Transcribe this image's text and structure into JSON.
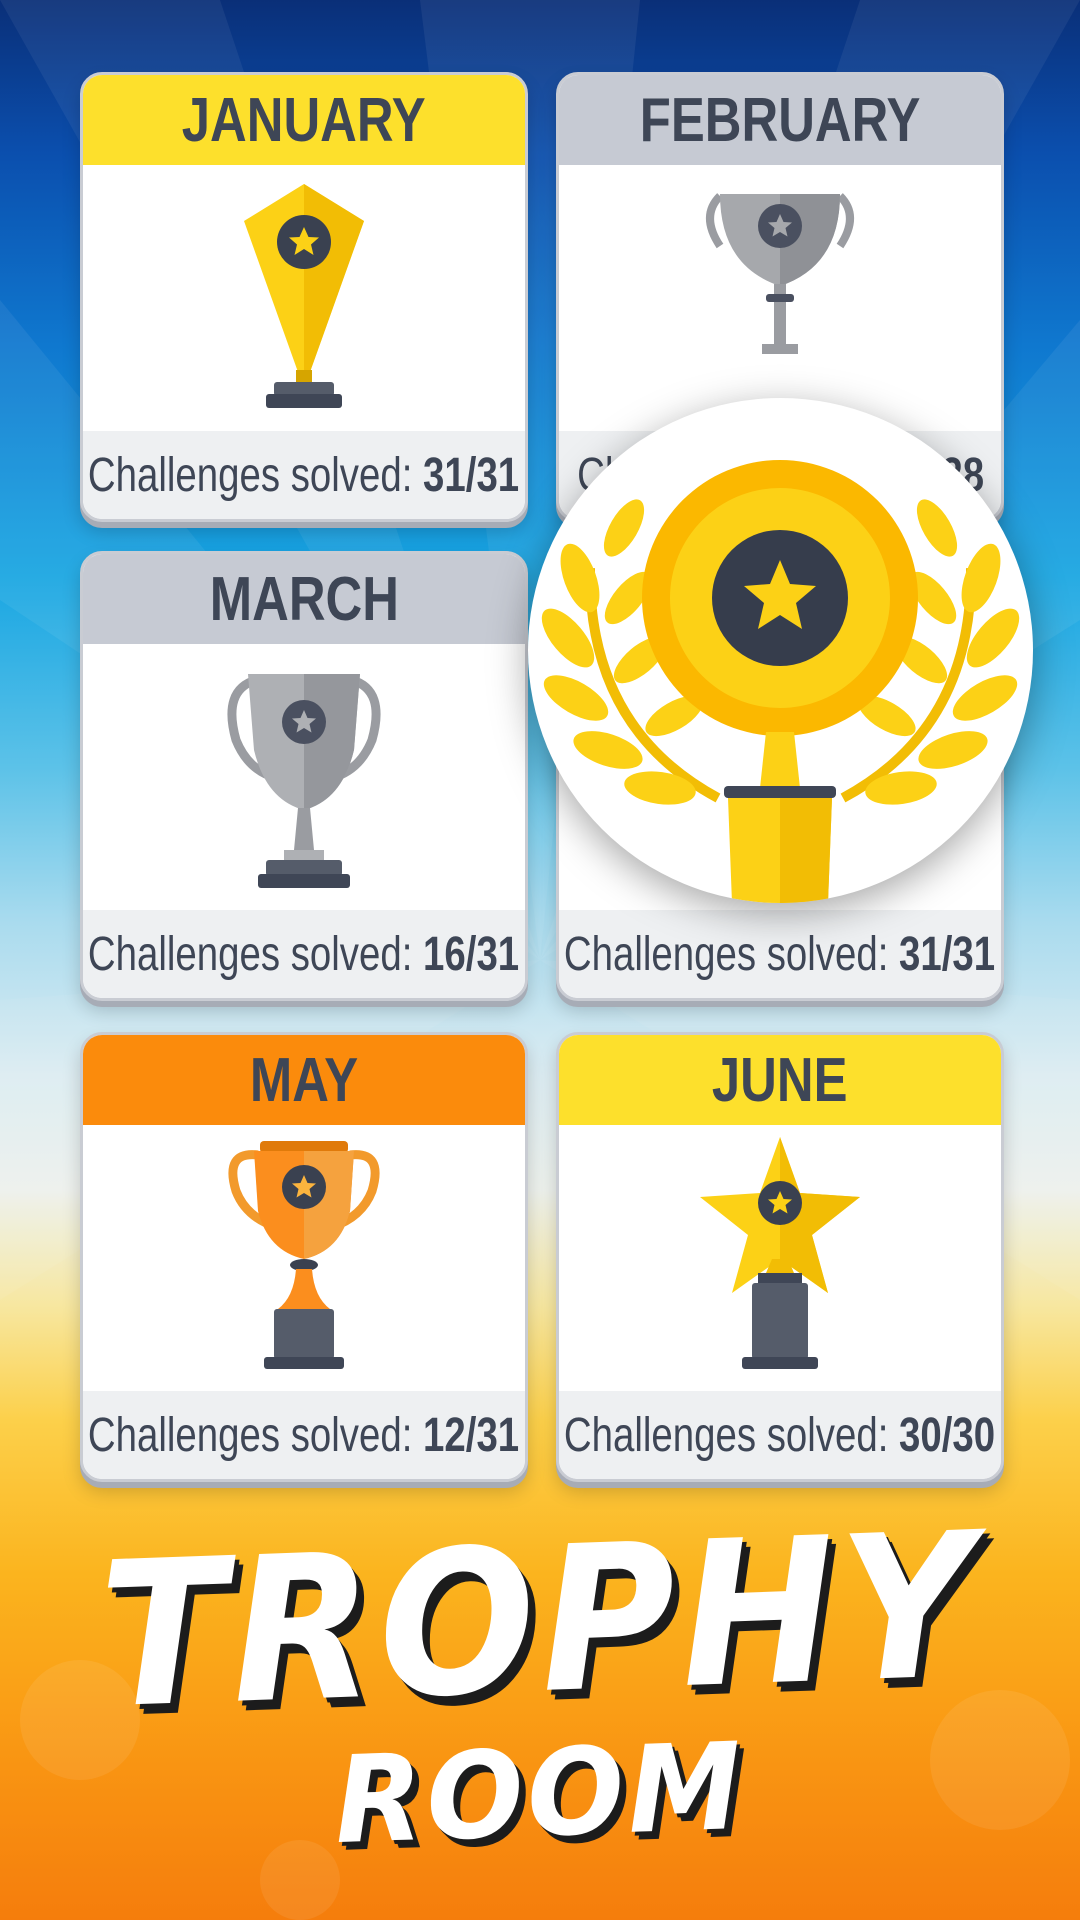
{
  "colors": {
    "header_yellow": "#fde02c",
    "header_grey": "#c6cad3",
    "header_orange": "#fb8b0c",
    "text_dark": "#3e4656",
    "gold": "#fcd116",
    "silver": "#a6a8ac",
    "bronze": "#fb8e1e"
  },
  "cards": [
    {
      "month": "JANUARY",
      "label": "Challenges solved:",
      "score": "31/31",
      "trophy": "gold-kite-trophy-icon"
    },
    {
      "month": "FEBRUARY",
      "label": "Ch",
      "score": "28",
      "trophy": "silver-cup-trophy-icon"
    },
    {
      "month": "MARCH",
      "label": "Challenges solved:",
      "score": "16/31",
      "trophy": "silver-handled-cup-icon"
    },
    {
      "month": "",
      "label": "Challenges solved:",
      "score": "31/31",
      "trophy": "gold-laurel-trophy-icon"
    },
    {
      "month": "MAY",
      "label": "Challenges solved:",
      "score": "12/31",
      "trophy": "bronze-cup-trophy-icon"
    },
    {
      "month": "JUNE",
      "label": "Challenges solved:",
      "score": "30/30",
      "trophy": "gold-star-trophy-icon"
    }
  ],
  "title": {
    "line1": "TROPHY",
    "line2": "ROOM"
  }
}
